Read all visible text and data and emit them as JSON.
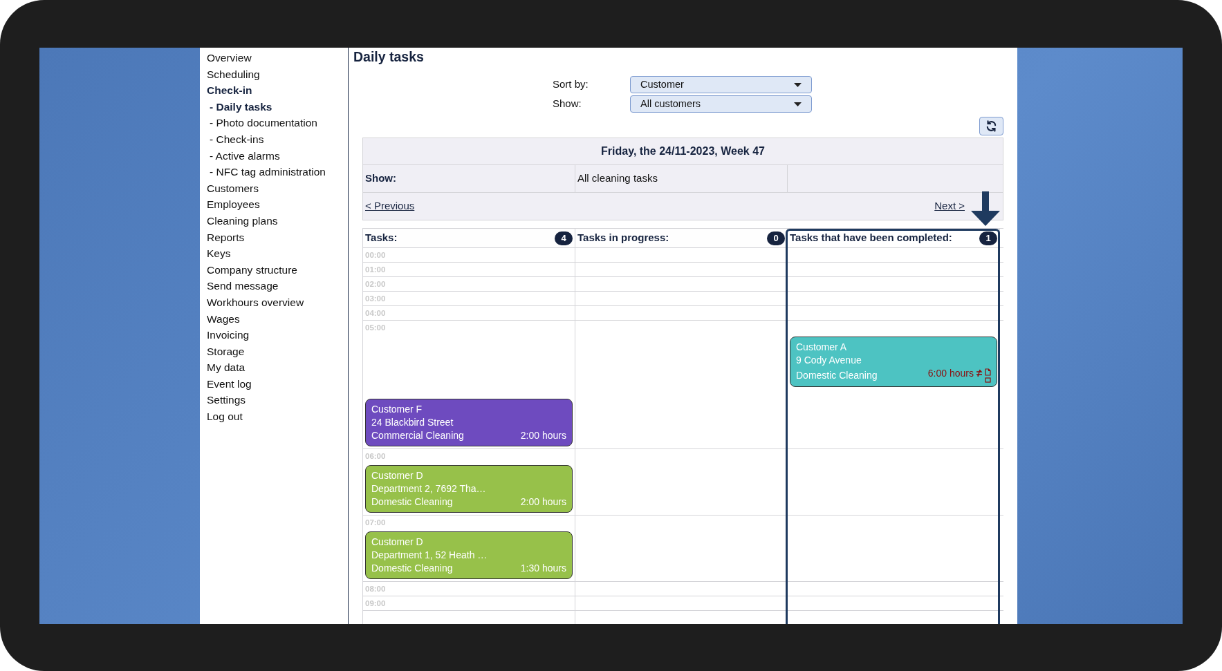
{
  "sidebar": {
    "items": [
      {
        "label": "Overview",
        "selected": false
      },
      {
        "label": "Scheduling",
        "selected": false
      },
      {
        "label": "Check-in",
        "selected": true,
        "children": [
          {
            "label": "- Daily tasks",
            "selected": true
          },
          {
            "label": "- Photo documentation",
            "selected": false
          },
          {
            "label": "- Check-ins",
            "selected": false
          },
          {
            "label": "- Active alarms",
            "selected": false
          },
          {
            "label": "- NFC tag administration",
            "selected": false
          }
        ]
      },
      {
        "label": "Customers",
        "selected": false
      },
      {
        "label": "Employees",
        "selected": false
      },
      {
        "label": "Cleaning plans",
        "selected": false
      },
      {
        "label": "Reports",
        "selected": false
      },
      {
        "label": "Keys",
        "selected": false
      },
      {
        "label": "Company structure",
        "selected": false
      },
      {
        "label": "Send message",
        "selected": false
      },
      {
        "label": "Workhours overview",
        "selected": false
      },
      {
        "label": "Wages",
        "selected": false
      },
      {
        "label": "Invoicing",
        "selected": false
      },
      {
        "label": "Storage",
        "selected": false
      },
      {
        "label": "My data",
        "selected": false
      },
      {
        "label": "Event log",
        "selected": false
      },
      {
        "label": "Settings",
        "selected": false
      },
      {
        "label": "Log out",
        "selected": false
      }
    ]
  },
  "page_title": "Daily tasks",
  "filters": [
    {
      "label": "Sort by:",
      "value": "Customer"
    },
    {
      "label": "Show:",
      "value": "All customers"
    }
  ],
  "date_header": "Friday, the 24/11-2023, Week 47",
  "show_row": {
    "label": "Show:",
    "value": "All cleaning tasks"
  },
  "navigation": {
    "previous": "< Previous",
    "next": "Next >"
  },
  "columns": [
    {
      "title": "Tasks:",
      "count": "4",
      "highlighted": false
    },
    {
      "title": "Tasks in progress:",
      "count": "0",
      "highlighted": false
    },
    {
      "title": "Tasks that have been completed:",
      "count": "1",
      "highlighted": true
    }
  ],
  "rows": [
    {
      "time": "00:00"
    },
    {
      "time": "01:00"
    },
    {
      "time": "02:00"
    },
    {
      "time": "03:00"
    },
    {
      "time": "04:00"
    },
    {
      "time": "05:00",
      "tasks": [
        {
          "kind": "planned",
          "customer": "Customer F",
          "address": "24 Blackbird Street",
          "service": "Commercial Cleaning",
          "duration": "2:00 hours",
          "color": "#6e4bbf"
        }
      ],
      "completed": [
        {
          "kind": "completed",
          "customer": "Customer A",
          "address": "9 Cody Avenue",
          "service": "Domestic Cleaning",
          "duration": "6:00 hours",
          "color": "#4dc3c2"
        }
      ]
    },
    {
      "time": "06:00",
      "tasks": [
        {
          "kind": "planned",
          "customer": "Customer D",
          "address": "Department 2, 7692 Tha…",
          "service": "Domestic Cleaning",
          "duration": "2:00 hours",
          "color": "#97c14a"
        }
      ]
    },
    {
      "time": "07:00",
      "tasks": [
        {
          "kind": "planned",
          "customer": "Customer D",
          "address": "Department 1, 52 Heath …",
          "service": "Domestic Cleaning",
          "duration": "1:30 hours",
          "color": "#97c14a"
        }
      ]
    },
    {
      "time": "08:00"
    },
    {
      "time": "09:00"
    }
  ]
}
